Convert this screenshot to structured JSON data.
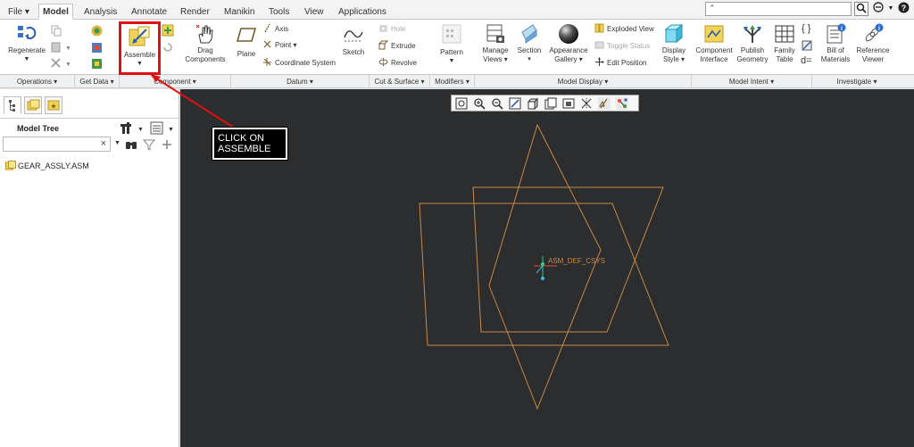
{
  "tabs": [
    "File ▾",
    "Model",
    "Analysis",
    "Annotate",
    "Render",
    "Manikin",
    "Tools",
    "View",
    "Applications"
  ],
  "search": {
    "placeholder": "",
    "value": ""
  },
  "ribbon": {
    "regenerate": "Regenerate",
    "assemble": "Assemble",
    "drag_components_1": "Drag",
    "drag_components_2": "Components",
    "plane": "Plane",
    "axis": "Axis",
    "point": "Point ▾",
    "coordinate_system": "Coordinate System",
    "sketch": "Sketch",
    "hole": "Hole",
    "extrude": "Extrude",
    "revolve": "Revolve",
    "pattern": "Pattern",
    "manage_views_1": "Manage",
    "manage_views_2": "Views ▾",
    "section_1": "Section",
    "section_2": "▾",
    "appearance_gallery_1": "Appearance",
    "appearance_gallery_2": "Gallery ▾",
    "exploded_view": "Exploded View",
    "toggle_status": "Toggle Status",
    "edit_position": "Edit Position",
    "display_style_1": "Display",
    "display_style_2": "Style ▾",
    "component_interface_1": "Component",
    "component_interface_2": "Interface",
    "publish_geometry_1": "Publish",
    "publish_geometry_2": "Geometry",
    "family_table_1": "Family",
    "family_table_2": "Table",
    "bill_of_materials_1": "Bill of",
    "bill_of_materials_2": "Materials",
    "reference_viewer_1": "Reference",
    "reference_viewer_2": "Viewer"
  },
  "groups": [
    "Operations ▾",
    "Get Data ▾",
    "Component ▾",
    "Datum ▾",
    "Cut & Surface ▾",
    "Modifiers ▾",
    "Model Display ▾",
    "Model Intent ▾",
    "Investigate ▾"
  ],
  "model_tree": {
    "title": "Model Tree",
    "filter_placeholder": "",
    "root": "GEAR_ASSLY.ASM"
  },
  "viewport": {
    "csys_label": "ASM_DEF_CSYS"
  },
  "callout": {
    "line1": "CLICK ON",
    "line2": "ASSEMBLE"
  },
  "colors": {
    "viewport_bg": "#2b2d2e",
    "datum_plane": "#c8894a",
    "highlight": "#e01010",
    "csys_label": "#c8894a"
  }
}
